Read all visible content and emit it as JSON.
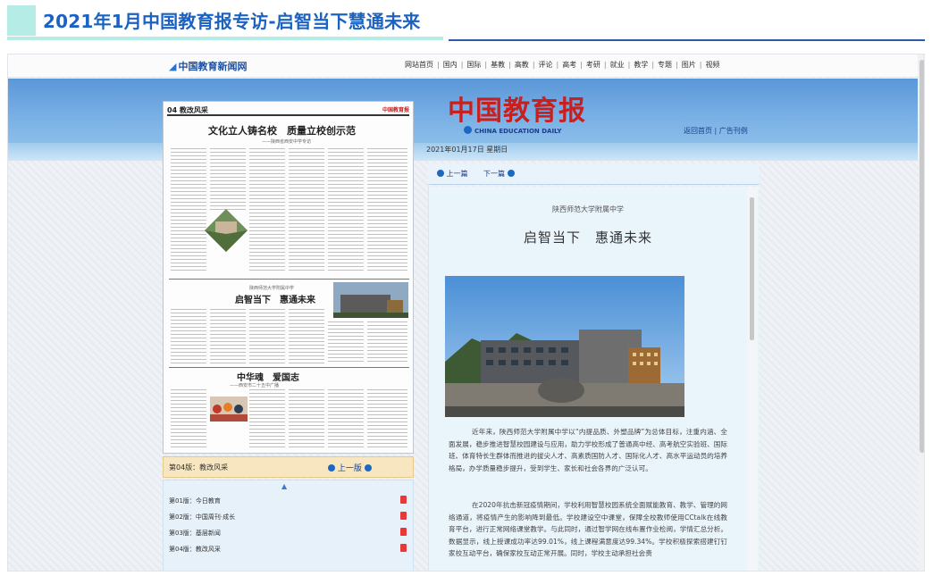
{
  "banner": {
    "title": "2021年1月中国教育报专访-启智当下慧通未来"
  },
  "site": {
    "logo": "中国教育新闻网",
    "nav": [
      "网站首页",
      "国内",
      "国际",
      "基教",
      "高教",
      "评论",
      "高考",
      "考研",
      "就业",
      "教学",
      "专题",
      "图片",
      "视频"
    ]
  },
  "masthead": {
    "title": "中国教育报",
    "en": "CHINA EDUCATION DAILY",
    "links": "返回首页 | 广告刊例"
  },
  "paper": {
    "page_label": "04 教改风采",
    "title1": "文化立人铸名校　质量立校创示范",
    "sub1": "——陕西省西安中学专访",
    "school": "陕西师范大学附属中学",
    "title2": "启智当下　惠通未来",
    "title3": "中华魂　爱国志",
    "sub3": "——西安市二十五中广播"
  },
  "edition": {
    "current": "第04版：教改风采",
    "prev": "上一版",
    "items": [
      "第01版：今日教育",
      "第02版：中国周刊·成长",
      "第03版：基层新闻",
      "第04版：教改风采"
    ]
  },
  "article": {
    "date": "2021年01月17日 星期日",
    "prev": "上一篇",
    "next": "下一篇",
    "school": "陕西师范大学附属中学",
    "title": "启智当下　惠通未来",
    "para1": "近年来，陕西师范大学附属中学以“内提品质、外塑品牌”为总体目标，注重内涵、全面发展，稳步推进智慧校园建设与应用，助力学校形成了普通高中经、高考航空实验班、国际班、体育特长生群体而推进的拔尖人才、高素质国防人才、国际化人才、高水平运动员的培养格局，办学质量稳步提升，受到学生、家长和社会各界的广泛认可。",
    "para2": "在2020年抗击新冠疫情期间，学校利用智慧校园系统全面赋能教育、教学、管理的网络通道，将疫情产生的影响降到最低。学校建设空中课堂，保障全校教师使用CCtalk在线教育平台，进行正常网络课堂教学。与此同时，通过智学网在线布置作业检阅，学情汇总分析。数据显示，线上授课成功率达99.01%，线上课程满意度达99.34%。学校积极探索搭建钉钉家校互动平台，确保家校互动正常开展。同时，学校主动承担社会责"
  }
}
